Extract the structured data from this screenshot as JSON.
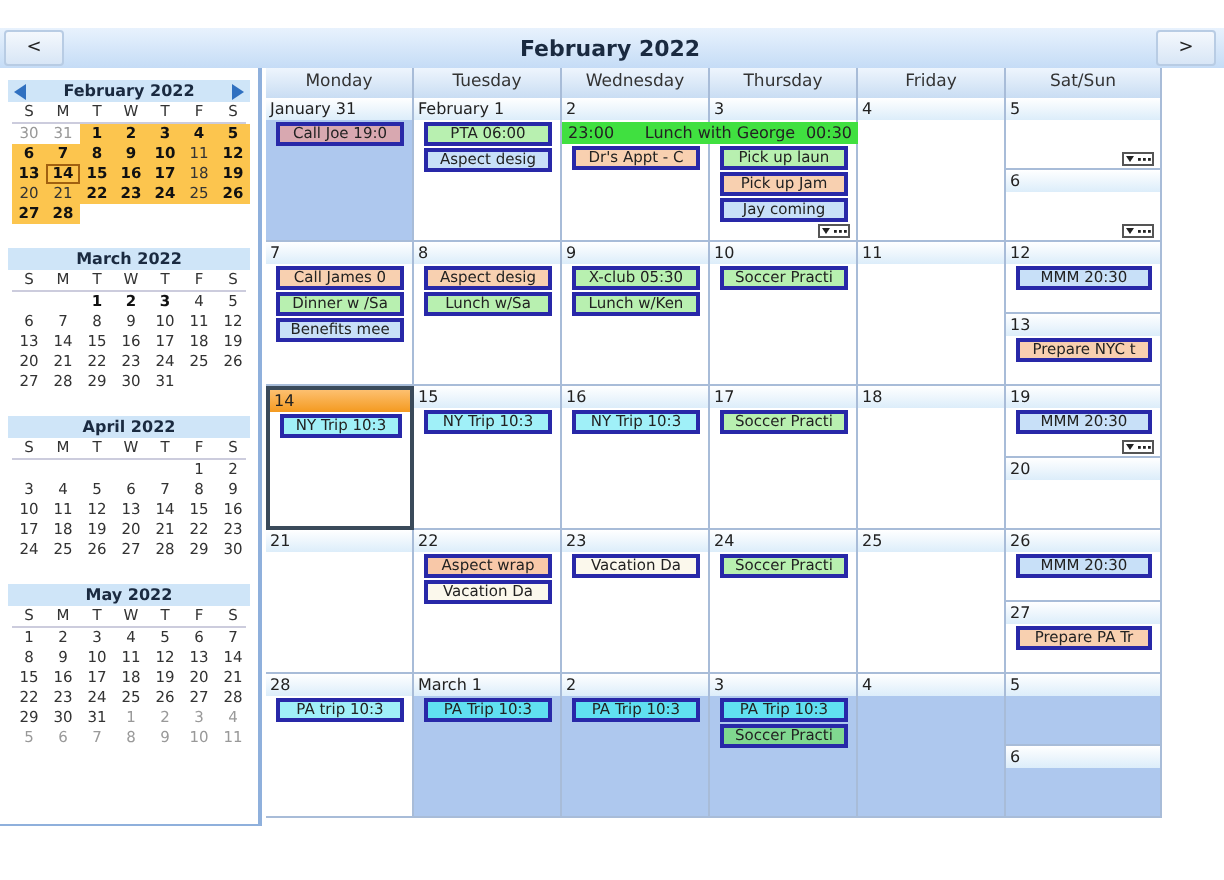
{
  "navigation": {
    "prev": "<",
    "title": "February 2022",
    "next": ">"
  },
  "mini_calendars": [
    {
      "title": "February 2022",
      "has_arrows": true,
      "weekdays": [
        "S",
        "M",
        "T",
        "W",
        "T",
        "F",
        "S"
      ],
      "weeks": [
        [
          {
            "text": "30",
            "bold": false,
            "dim": true,
            "selected": false,
            "today": false
          },
          {
            "text": "31",
            "bold": false,
            "dim": true,
            "selected": false,
            "today": false
          },
          {
            "text": "1",
            "bold": true,
            "dim": false,
            "selected": true,
            "today": false
          },
          {
            "text": "2",
            "bold": true,
            "dim": false,
            "selected": true,
            "today": false
          },
          {
            "text": "3",
            "bold": true,
            "dim": false,
            "selected": true,
            "today": false
          },
          {
            "text": "4",
            "bold": true,
            "dim": false,
            "selected": true,
            "today": false
          },
          {
            "text": "5",
            "bold": true,
            "dim": false,
            "selected": true,
            "today": false
          }
        ],
        [
          {
            "text": "6",
            "bold": true,
            "dim": false,
            "selected": true,
            "today": false
          },
          {
            "text": "7",
            "bold": true,
            "dim": false,
            "selected": true,
            "today": false
          },
          {
            "text": "8",
            "bold": true,
            "dim": false,
            "selected": true,
            "today": false
          },
          {
            "text": "9",
            "bold": true,
            "dim": false,
            "selected": true,
            "today": false
          },
          {
            "text": "10",
            "bold": true,
            "dim": false,
            "selected": true,
            "today": false
          },
          {
            "text": "11",
            "bold": false,
            "dim": false,
            "selected": true,
            "today": false
          },
          {
            "text": "12",
            "bold": true,
            "dim": false,
            "selected": true,
            "today": false
          }
        ],
        [
          {
            "text": "13",
            "bold": true,
            "dim": false,
            "selected": true,
            "today": false
          },
          {
            "text": "14",
            "bold": true,
            "dim": false,
            "selected": true,
            "today": true
          },
          {
            "text": "15",
            "bold": true,
            "dim": false,
            "selected": true,
            "today": false
          },
          {
            "text": "16",
            "bold": true,
            "dim": false,
            "selected": true,
            "today": false
          },
          {
            "text": "17",
            "bold": true,
            "dim": false,
            "selected": true,
            "today": false
          },
          {
            "text": "18",
            "bold": false,
            "dim": false,
            "selected": true,
            "today": false
          },
          {
            "text": "19",
            "bold": true,
            "dim": false,
            "selected": true,
            "today": false
          }
        ],
        [
          {
            "text": "20",
            "bold": false,
            "dim": false,
            "selected": true,
            "today": false
          },
          {
            "text": "21",
            "bold": false,
            "dim": false,
            "selected": true,
            "today": false
          },
          {
            "text": "22",
            "bold": true,
            "dim": false,
            "selected": true,
            "today": false
          },
          {
            "text": "23",
            "bold": true,
            "dim": false,
            "selected": true,
            "today": false
          },
          {
            "text": "24",
            "bold": true,
            "dim": false,
            "selected": true,
            "today": false
          },
          {
            "text": "25",
            "bold": false,
            "dim": false,
            "selected": true,
            "today": false
          },
          {
            "text": "26",
            "bold": true,
            "dim": false,
            "selected": true,
            "today": false
          }
        ],
        [
          {
            "text": "27",
            "bold": true,
            "dim": false,
            "selected": true,
            "today": false
          },
          {
            "text": "28",
            "bold": true,
            "dim": false,
            "selected": true,
            "today": false
          }
        ]
      ]
    },
    {
      "title": "March 2022",
      "has_arrows": false,
      "weekdays": [
        "S",
        "M",
        "T",
        "W",
        "T",
        "F",
        "S"
      ],
      "weeks": [
        [
          {
            "text": "1",
            "bold": true,
            "dim": false,
            "selected": false,
            "today": false
          },
          {
            "text": "2",
            "bold": true,
            "dim": false,
            "selected": false,
            "today": false
          },
          {
            "text": "3",
            "bold": true,
            "dim": false,
            "selected": false,
            "today": false
          },
          {
            "text": "4",
            "bold": false,
            "dim": false,
            "selected": false,
            "today": false
          },
          {
            "text": "5",
            "bold": false,
            "dim": false,
            "selected": false,
            "today": false
          }
        ],
        [
          {
            "text": "6",
            "bold": false,
            "dim": false,
            "selected": false,
            "today": false
          },
          {
            "text": "7",
            "bold": false,
            "dim": false,
            "selected": false,
            "today": false
          },
          {
            "text": "8",
            "bold": false,
            "dim": false,
            "selected": false,
            "today": false
          },
          {
            "text": "9",
            "bold": false,
            "dim": false,
            "selected": false,
            "today": false
          },
          {
            "text": "10",
            "bold": false,
            "dim": false,
            "selected": false,
            "today": false
          },
          {
            "text": "11",
            "bold": false,
            "dim": false,
            "selected": false,
            "today": false
          },
          {
            "text": "12",
            "bold": false,
            "dim": false,
            "selected": false,
            "today": false
          }
        ],
        [
          {
            "text": "13",
            "bold": false,
            "dim": false,
            "selected": false,
            "today": false
          },
          {
            "text": "14",
            "bold": false,
            "dim": false,
            "selected": false,
            "today": false
          },
          {
            "text": "15",
            "bold": false,
            "dim": false,
            "selected": false,
            "today": false
          },
          {
            "text": "16",
            "bold": false,
            "dim": false,
            "selected": false,
            "today": false
          },
          {
            "text": "17",
            "bold": false,
            "dim": false,
            "selected": false,
            "today": false
          },
          {
            "text": "18",
            "bold": false,
            "dim": false,
            "selected": false,
            "today": false
          },
          {
            "text": "19",
            "bold": false,
            "dim": false,
            "selected": false,
            "today": false
          }
        ],
        [
          {
            "text": "20",
            "bold": false,
            "dim": false,
            "selected": false,
            "today": false
          },
          {
            "text": "21",
            "bold": false,
            "dim": false,
            "selected": false,
            "today": false
          },
          {
            "text": "22",
            "bold": false,
            "dim": false,
            "selected": false,
            "today": false
          },
          {
            "text": "23",
            "bold": false,
            "dim": false,
            "selected": false,
            "today": false
          },
          {
            "text": "24",
            "bold": false,
            "dim": false,
            "selected": false,
            "today": false
          },
          {
            "text": "25",
            "bold": false,
            "dim": false,
            "selected": false,
            "today": false
          },
          {
            "text": "26",
            "bold": false,
            "dim": false,
            "selected": false,
            "today": false
          }
        ],
        [
          {
            "text": "27",
            "bold": false,
            "dim": false,
            "selected": false,
            "today": false
          },
          {
            "text": "28",
            "bold": false,
            "dim": false,
            "selected": false,
            "today": false
          },
          {
            "text": "29",
            "bold": false,
            "dim": false,
            "selected": false,
            "today": false
          },
          {
            "text": "30",
            "bold": false,
            "dim": false,
            "selected": false,
            "today": false
          },
          {
            "text": "31",
            "bold": false,
            "dim": false,
            "selected": false,
            "today": false
          }
        ]
      ]
    },
    {
      "title": "April 2022",
      "has_arrows": false,
      "weekdays": [
        "S",
        "M",
        "T",
        "W",
        "T",
        "F",
        "S"
      ],
      "weeks": [
        [
          {
            "text": "1",
            "bold": false,
            "dim": false,
            "selected": false,
            "today": false
          },
          {
            "text": "2",
            "bold": false,
            "dim": false,
            "selected": false,
            "today": false
          }
        ],
        [
          {
            "text": "3",
            "bold": false,
            "dim": false,
            "selected": false,
            "today": false
          },
          {
            "text": "4",
            "bold": false,
            "dim": false,
            "selected": false,
            "today": false
          },
          {
            "text": "5",
            "bold": false,
            "dim": false,
            "selected": false,
            "today": false
          },
          {
            "text": "6",
            "bold": false,
            "dim": false,
            "selected": false,
            "today": false
          },
          {
            "text": "7",
            "bold": false,
            "dim": false,
            "selected": false,
            "today": false
          },
          {
            "text": "8",
            "bold": false,
            "dim": false,
            "selected": false,
            "today": false
          },
          {
            "text": "9",
            "bold": false,
            "dim": false,
            "selected": false,
            "today": false
          }
        ],
        [
          {
            "text": "10",
            "bold": false,
            "dim": false,
            "selected": false,
            "today": false
          },
          {
            "text": "11",
            "bold": false,
            "dim": false,
            "selected": false,
            "today": false
          },
          {
            "text": "12",
            "bold": false,
            "dim": false,
            "selected": false,
            "today": false
          },
          {
            "text": "13",
            "bold": false,
            "dim": false,
            "selected": false,
            "today": false
          },
          {
            "text": "14",
            "bold": false,
            "dim": false,
            "selected": false,
            "today": false
          },
          {
            "text": "15",
            "bold": false,
            "dim": false,
            "selected": false,
            "today": false
          },
          {
            "text": "16",
            "bold": false,
            "dim": false,
            "selected": false,
            "today": false
          }
        ],
        [
          {
            "text": "17",
            "bold": false,
            "dim": false,
            "selected": false,
            "today": false
          },
          {
            "text": "18",
            "bold": false,
            "dim": false,
            "selected": false,
            "today": false
          },
          {
            "text": "19",
            "bold": false,
            "dim": false,
            "selected": false,
            "today": false
          },
          {
            "text": "20",
            "bold": false,
            "dim": false,
            "selected": false,
            "today": false
          },
          {
            "text": "21",
            "bold": false,
            "dim": false,
            "selected": false,
            "today": false
          },
          {
            "text": "22",
            "bold": false,
            "dim": false,
            "selected": false,
            "today": false
          },
          {
            "text": "23",
            "bold": false,
            "dim": false,
            "selected": false,
            "today": false
          }
        ],
        [
          {
            "text": "24",
            "bold": false,
            "dim": false,
            "selected": false,
            "today": false
          },
          {
            "text": "25",
            "bold": false,
            "dim": false,
            "selected": false,
            "today": false
          },
          {
            "text": "26",
            "bold": false,
            "dim": false,
            "selected": false,
            "today": false
          },
          {
            "text": "27",
            "bold": false,
            "dim": false,
            "selected": false,
            "today": false
          },
          {
            "text": "28",
            "bold": false,
            "dim": false,
            "selected": false,
            "today": false
          },
          {
            "text": "29",
            "bold": false,
            "dim": false,
            "selected": false,
            "today": false
          },
          {
            "text": "30",
            "bold": false,
            "dim": false,
            "selected": false,
            "today": false
          }
        ]
      ]
    },
    {
      "title": "May 2022",
      "has_arrows": false,
      "weekdays": [
        "S",
        "M",
        "T",
        "W",
        "T",
        "F",
        "S"
      ],
      "weeks": [
        [
          {
            "text": "1",
            "bold": false,
            "dim": false,
            "selected": false,
            "today": false
          },
          {
            "text": "2",
            "bold": false,
            "dim": false,
            "selected": false,
            "today": false
          },
          {
            "text": "3",
            "bold": false,
            "dim": false,
            "selected": false,
            "today": false
          },
          {
            "text": "4",
            "bold": false,
            "dim": false,
            "selected": false,
            "today": false
          },
          {
            "text": "5",
            "bold": false,
            "dim": false,
            "selected": false,
            "today": false
          },
          {
            "text": "6",
            "bold": false,
            "dim": false,
            "selected": false,
            "today": false
          },
          {
            "text": "7",
            "bold": false,
            "dim": false,
            "selected": false,
            "today": false
          }
        ],
        [
          {
            "text": "8",
            "bold": false,
            "dim": false,
            "selected": false,
            "today": false
          },
          {
            "text": "9",
            "bold": false,
            "dim": false,
            "selected": false,
            "today": false
          },
          {
            "text": "10",
            "bold": false,
            "dim": false,
            "selected": false,
            "today": false
          },
          {
            "text": "11",
            "bold": false,
            "dim": false,
            "selected": false,
            "today": false
          },
          {
            "text": "12",
            "bold": false,
            "dim": false,
            "selected": false,
            "today": false
          },
          {
            "text": "13",
            "bold": false,
            "dim": false,
            "selected": false,
            "today": false
          },
          {
            "text": "14",
            "bold": false,
            "dim": false,
            "selected": false,
            "today": false
          }
        ],
        [
          {
            "text": "15",
            "bold": false,
            "dim": false,
            "selected": false,
            "today": false
          },
          {
            "text": "16",
            "bold": false,
            "dim": false,
            "selected": false,
            "today": false
          },
          {
            "text": "17",
            "bold": false,
            "dim": false,
            "selected": false,
            "today": false
          },
          {
            "text": "18",
            "bold": false,
            "dim": false,
            "selected": false,
            "today": false
          },
          {
            "text": "19",
            "bold": false,
            "dim": false,
            "selected": false,
            "today": false
          },
          {
            "text": "20",
            "bold": false,
            "dim": false,
            "selected": false,
            "today": false
          },
          {
            "text": "21",
            "bold": false,
            "dim": false,
            "selected": false,
            "today": false
          }
        ],
        [
          {
            "text": "22",
            "bold": false,
            "dim": false,
            "selected": false,
            "today": false
          },
          {
            "text": "23",
            "bold": false,
            "dim": false,
            "selected": false,
            "today": false
          },
          {
            "text": "24",
            "bold": false,
            "dim": false,
            "selected": false,
            "today": false
          },
          {
            "text": "25",
            "bold": false,
            "dim": false,
            "selected": false,
            "today": false
          },
          {
            "text": "26",
            "bold": false,
            "dim": false,
            "selected": false,
            "today": false
          },
          {
            "text": "27",
            "bold": false,
            "dim": false,
            "selected": false,
            "today": false
          },
          {
            "text": "28",
            "bold": false,
            "dim": false,
            "selected": false,
            "today": false
          }
        ],
        [
          {
            "text": "29",
            "bold": false,
            "dim": false,
            "selected": false,
            "today": false
          },
          {
            "text": "30",
            "bold": false,
            "dim": false,
            "selected": false,
            "today": false
          },
          {
            "text": "31",
            "bold": false,
            "dim": false,
            "selected": false,
            "today": false
          },
          {
            "text": "1",
            "bold": false,
            "dim": true,
            "selected": false,
            "today": false
          },
          {
            "text": "2",
            "bold": false,
            "dim": true,
            "selected": false,
            "today": false
          },
          {
            "text": "3",
            "bold": false,
            "dim": true,
            "selected": false,
            "today": false
          },
          {
            "text": "4",
            "bold": false,
            "dim": true,
            "selected": false,
            "today": false
          }
        ],
        [
          {
            "text": "5",
            "bold": false,
            "dim": true,
            "selected": false,
            "today": false
          },
          {
            "text": "6",
            "bold": false,
            "dim": true,
            "selected": false,
            "today": false
          },
          {
            "text": "7",
            "bold": false,
            "dim": true,
            "selected": false,
            "today": false
          },
          {
            "text": "8",
            "bold": false,
            "dim": true,
            "selected": false,
            "today": false
          },
          {
            "text": "9",
            "bold": false,
            "dim": true,
            "selected": false,
            "today": false
          },
          {
            "text": "10",
            "bold": false,
            "dim": true,
            "selected": false,
            "today": false
          },
          {
            "text": "11",
            "bold": false,
            "dim": true,
            "selected": false,
            "today": false
          }
        ]
      ]
    }
  ],
  "month_view": {
    "columns": [
      "Monday",
      "Tuesday",
      "Wednesday",
      "Thursday",
      "Friday",
      "Sat/Sun"
    ],
    "weeks": [
      {
        "days": [
          {
            "label": "January 31",
            "out_of_month": true,
            "today": false,
            "spanned": false,
            "more": false,
            "events": [
              {
                "kind": "single",
                "text": "Call Joe 19:0",
                "color": "#d8a8b0"
              }
            ]
          },
          {
            "label": "February 1",
            "out_of_month": false,
            "today": false,
            "spanned": false,
            "more": false,
            "events": [
              {
                "kind": "single",
                "text": "PTA 06:00",
                "color": "#b8f0b0"
              },
              {
                "kind": "single",
                "text": "Aspect desig",
                "color": "#c8e0f8"
              }
            ]
          },
          {
            "label": "2",
            "out_of_month": false,
            "today": false,
            "spanned": false,
            "more": false,
            "events": [
              {
                "kind": "multi_day",
                "start": "23:00",
                "text": "Lunch with George",
                "end": "00:30",
                "color": "#40e040"
              },
              {
                "kind": "single",
                "text": "Dr's Appt - C",
                "color": "#f8d0b0"
              }
            ]
          },
          {
            "label": "3",
            "out_of_month": false,
            "today": false,
            "spanned": true,
            "more": true,
            "events": [
              {
                "kind": "single",
                "text": "Pick up laun",
                "color": "#b8f0b0"
              },
              {
                "kind": "single",
                "text": "Pick up Jam",
                "color": "#f8d0b0"
              },
              {
                "kind": "single",
                "text": "Jay coming",
                "color": "#c8e0f8"
              }
            ]
          },
          {
            "label": "4",
            "out_of_month": false,
            "today": false,
            "spanned": false,
            "more": false
          }
        ],
        "weekend": [
          {
            "label": "5",
            "out_of_month": false,
            "today": false,
            "spanned": false,
            "more": true
          },
          {
            "label": "6",
            "out_of_month": false,
            "today": false,
            "spanned": false,
            "more": true
          }
        ]
      },
      {
        "days": [
          {
            "label": "7",
            "out_of_month": false,
            "today": false,
            "spanned": false,
            "more": false,
            "events": [
              {
                "kind": "single",
                "text": "Call James 0",
                "color": "#f8d0b0"
              },
              {
                "kind": "single",
                "text": "Dinner w /Sa",
                "color": "#b8f0b0"
              },
              {
                "kind": "single",
                "text": "Benefits mee",
                "color": "#c8e0f8"
              }
            ]
          },
          {
            "label": "8",
            "out_of_month": false,
            "today": false,
            "spanned": false,
            "more": false,
            "events": [
              {
                "kind": "single",
                "text": "Aspect desig",
                "color": "#f8d0b0"
              },
              {
                "kind": "single",
                "text": "Lunch w/Sa",
                "color": "#b8f0b0"
              }
            ]
          },
          {
            "label": "9",
            "out_of_month": false,
            "today": false,
            "spanned": false,
            "more": false,
            "events": [
              {
                "kind": "single",
                "text": "X-club 05:30",
                "color": "#b8f0b0"
              },
              {
                "kind": "single",
                "text": "Lunch w/Ken",
                "color": "#b8f0b0"
              }
            ]
          },
          {
            "label": "10",
            "out_of_month": false,
            "today": false,
            "spanned": false,
            "more": false,
            "events": [
              {
                "kind": "single",
                "text": "Soccer Practi",
                "color": "#b8f0b0"
              }
            ]
          },
          {
            "label": "11",
            "out_of_month": false,
            "today": false,
            "spanned": false,
            "more": false
          }
        ],
        "weekend": [
          {
            "label": "12",
            "out_of_month": false,
            "today": false,
            "spanned": false,
            "more": false,
            "events": [
              {
                "kind": "single",
                "text": "MMM 20:30",
                "color": "#c8e0f8"
              }
            ]
          },
          {
            "label": "13",
            "out_of_month": false,
            "today": false,
            "spanned": false,
            "more": false,
            "events": [
              {
                "kind": "single",
                "text": "Prepare NYC t",
                "color": "#f8d0b0"
              }
            ]
          }
        ]
      },
      {
        "days": [
          {
            "label": "14",
            "out_of_month": false,
            "today": true,
            "spanned": false,
            "more": false,
            "events": [
              {
                "kind": "single",
                "text": "NY Trip 10:3",
                "color": "#a0f0f8"
              }
            ]
          },
          {
            "label": "15",
            "out_of_month": false,
            "today": false,
            "spanned": false,
            "more": false,
            "events": [
              {
                "kind": "single",
                "text": "NY Trip 10:3",
                "color": "#a0f0f8"
              }
            ]
          },
          {
            "label": "16",
            "out_of_month": false,
            "today": false,
            "spanned": false,
            "more": false,
            "events": [
              {
                "kind": "single",
                "text": "NY Trip 10:3",
                "color": "#a0f0f8"
              }
            ]
          },
          {
            "label": "17",
            "out_of_month": false,
            "today": false,
            "spanned": false,
            "more": false,
            "events": [
              {
                "kind": "single",
                "text": "Soccer Practi",
                "color": "#b8f0b0"
              }
            ]
          },
          {
            "label": "18",
            "out_of_month": false,
            "today": false,
            "spanned": false,
            "more": false
          }
        ],
        "weekend": [
          {
            "label": "19",
            "out_of_month": false,
            "today": false,
            "spanned": false,
            "more": true,
            "events": [
              {
                "kind": "single",
                "text": "MMM 20:30",
                "color": "#c8e0f8"
              }
            ]
          },
          {
            "label": "20",
            "out_of_month": false,
            "today": false,
            "spanned": false,
            "more": false
          }
        ]
      },
      {
        "days": [
          {
            "label": "21",
            "out_of_month": false,
            "today": false,
            "spanned": false,
            "more": false
          },
          {
            "label": "22",
            "out_of_month": false,
            "today": false,
            "spanned": false,
            "more": false,
            "events": [
              {
                "kind": "single",
                "text": "Aspect wrap",
                "color": "#f8c8a8"
              },
              {
                "kind": "single",
                "text": "Vacation Da",
                "color": "#fbf8ec"
              }
            ]
          },
          {
            "label": "23",
            "out_of_month": false,
            "today": false,
            "spanned": false,
            "more": false,
            "events": [
              {
                "kind": "single",
                "text": "Vacation Da",
                "color": "#fbf8ec"
              }
            ]
          },
          {
            "label": "24",
            "out_of_month": false,
            "today": false,
            "spanned": false,
            "more": false,
            "events": [
              {
                "kind": "single",
                "text": "Soccer Practi",
                "color": "#b8f0b0"
              }
            ]
          },
          {
            "label": "25",
            "out_of_month": false,
            "today": false,
            "spanned": false,
            "more": false
          }
        ],
        "weekend": [
          {
            "label": "26",
            "out_of_month": false,
            "today": false,
            "spanned": false,
            "more": false,
            "events": [
              {
                "kind": "single",
                "text": "MMM 20:30",
                "color": "#c8e0f8"
              }
            ]
          },
          {
            "label": "27",
            "out_of_month": false,
            "today": false,
            "spanned": false,
            "more": false,
            "events": [
              {
                "kind": "single",
                "text": "Prepare PA Tr",
                "color": "#f8d0b0"
              }
            ]
          }
        ]
      },
      {
        "days": [
          {
            "label": "28",
            "out_of_month": false,
            "today": false,
            "spanned": false,
            "more": false,
            "events": [
              {
                "kind": "single",
                "text": "PA trip 10:3",
                "color": "#a0f0f8"
              }
            ]
          },
          {
            "label": "March 1",
            "out_of_month": true,
            "today": false,
            "spanned": false,
            "more": false,
            "events": [
              {
                "kind": "single",
                "text": "PA Trip 10:3",
                "color": "#60e0f0"
              }
            ]
          },
          {
            "label": "2",
            "out_of_month": true,
            "today": false,
            "spanned": false,
            "more": false,
            "events": [
              {
                "kind": "single",
                "text": "PA Trip 10:3",
                "color": "#60e0f0"
              }
            ]
          },
          {
            "label": "3",
            "out_of_month": true,
            "today": false,
            "spanned": false,
            "more": false,
            "events": [
              {
                "kind": "single",
                "text": "PA Trip 10:3",
                "color": "#60e0f0"
              },
              {
                "kind": "single",
                "text": "Soccer Practi",
                "color": "#80d890"
              }
            ]
          },
          {
            "label": "4",
            "out_of_month": true,
            "today": false,
            "spanned": false,
            "more": false
          }
        ],
        "weekend": [
          {
            "label": "5",
            "out_of_month": true,
            "today": false,
            "spanned": false,
            "more": false
          },
          {
            "label": "6",
            "out_of_month": true,
            "today": false,
            "spanned": false,
            "more": false
          }
        ]
      }
    ]
  }
}
